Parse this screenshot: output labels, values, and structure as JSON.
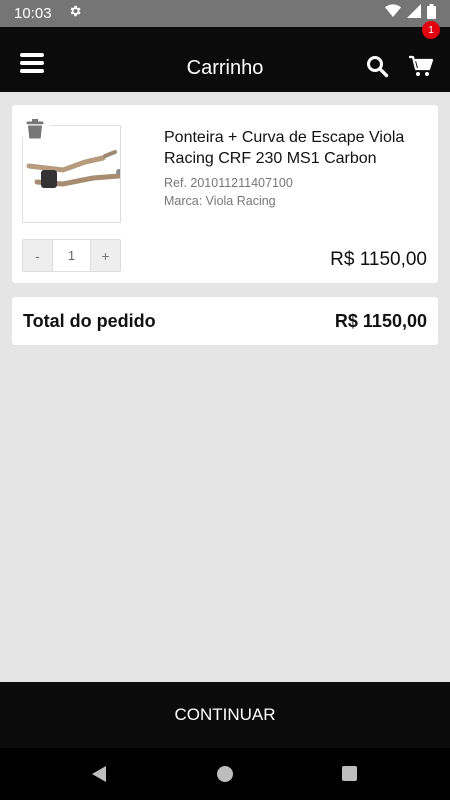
{
  "status": {
    "time": "10:03"
  },
  "header": {
    "title": "Carrinho",
    "cart_count": "1"
  },
  "cart_item": {
    "name": "Ponteira + Curva de Escape Viola Racing CRF 230 MS1 Carbon",
    "ref": "Ref. 201011211407100",
    "brand": "Marca: Viola Racing",
    "quantity": "1",
    "minus_label": "-",
    "plus_label": "+",
    "price": "R$ 1150,00"
  },
  "total": {
    "label": "Total do pedido",
    "value": "R$ 1150,00"
  },
  "footer": {
    "continue_label": "CONTINUAR"
  },
  "colors": {
    "app_bar": "#0b0b0b",
    "badge": "#e0000f",
    "background": "#e5e5e5"
  },
  "icons": [
    "gear-icon",
    "wifi-icon",
    "signal-icon",
    "battery-icon",
    "menu-icon",
    "search-icon",
    "cart-icon",
    "trash-icon",
    "back-icon",
    "home-icon",
    "recent-apps-icon"
  ]
}
